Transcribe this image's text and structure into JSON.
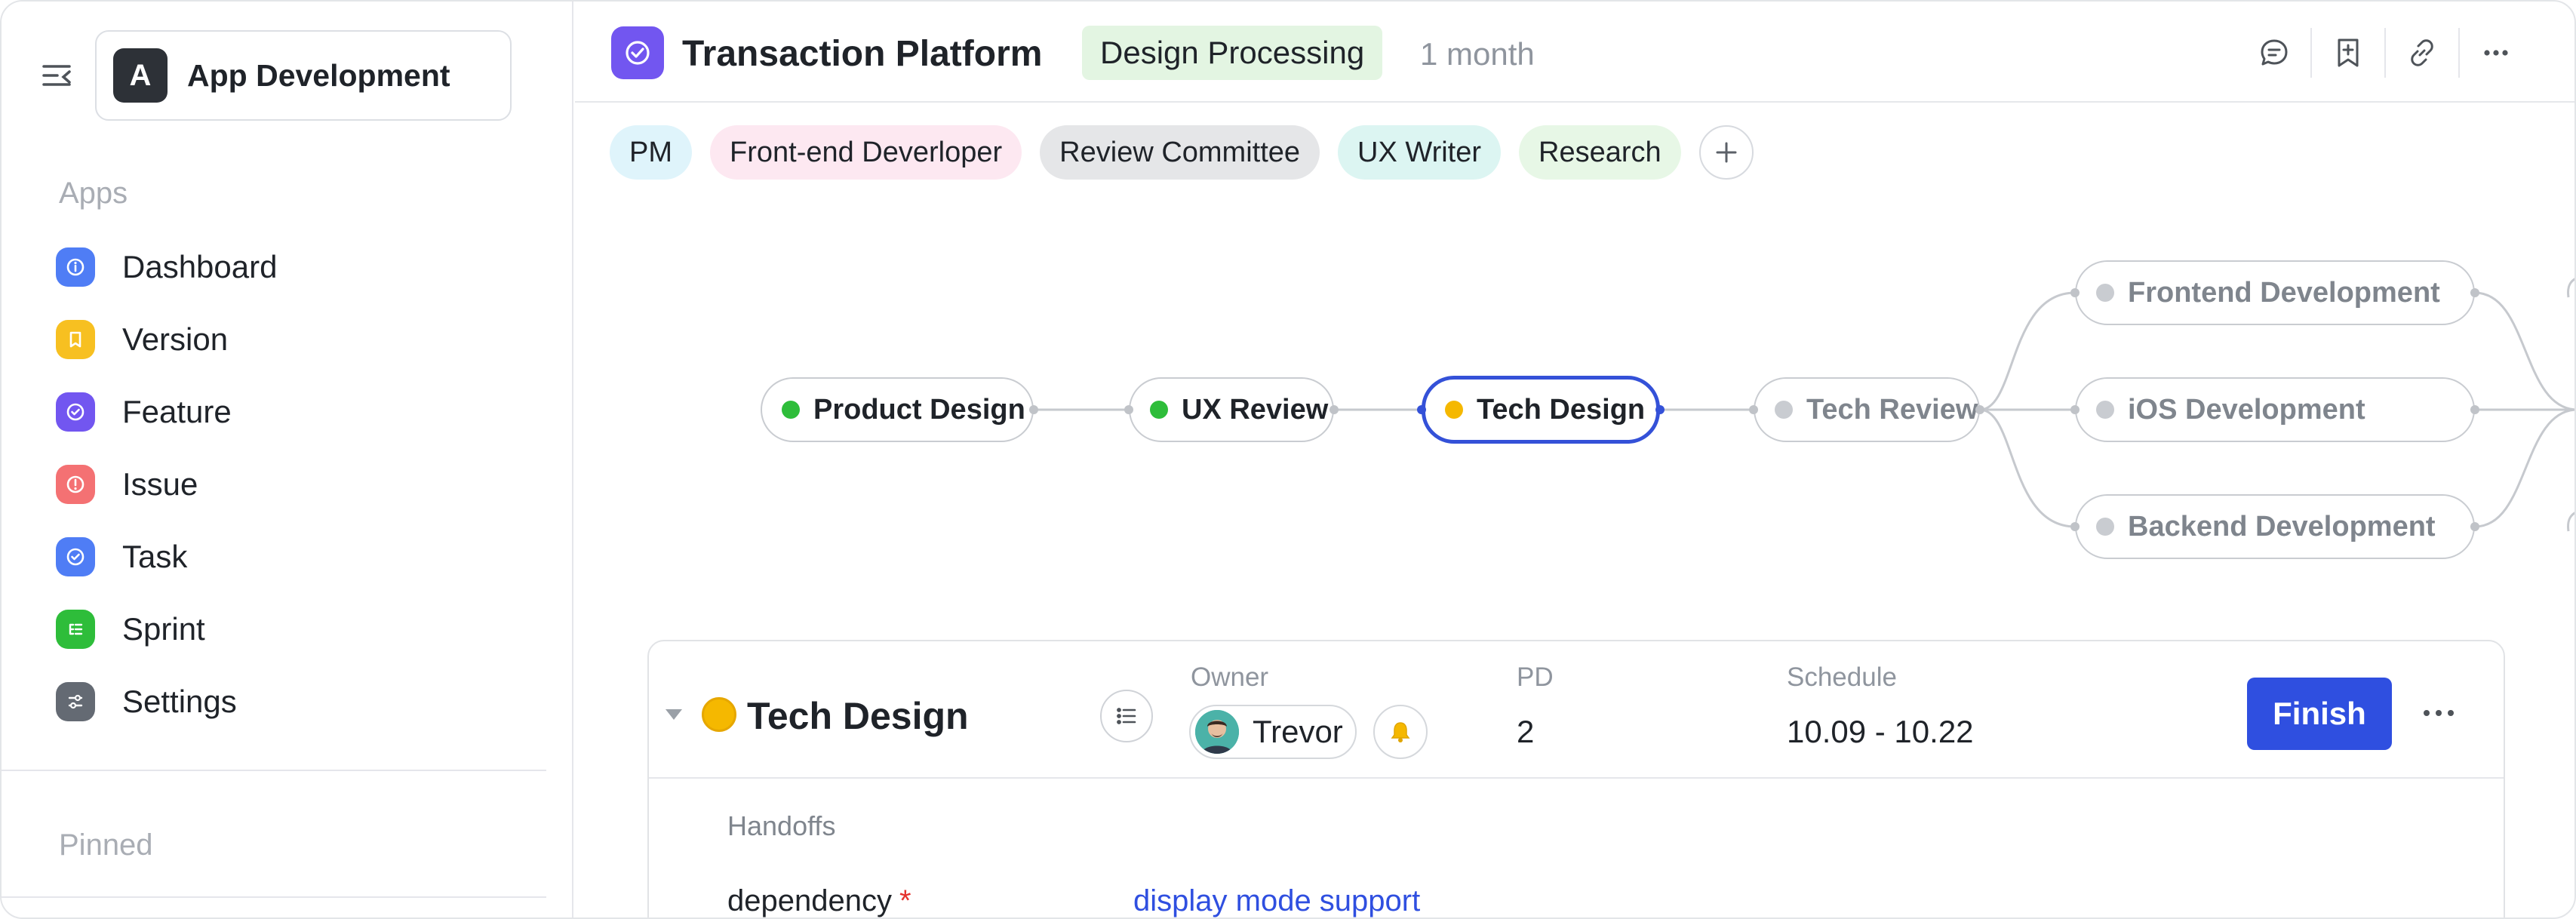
{
  "sidebar": {
    "workspace": {
      "initial": "A",
      "name": "App Development"
    },
    "apps_title": "Apps",
    "items": [
      {
        "label": "Dashboard",
        "icon": "info-icon",
        "color": "#4f7df5"
      },
      {
        "label": "Version",
        "icon": "bookmark-icon",
        "color": "#f7c021"
      },
      {
        "label": "Feature",
        "icon": "check-circle-icon",
        "color": "#7256f0"
      },
      {
        "label": "Issue",
        "icon": "alert-icon",
        "color": "#f47173"
      },
      {
        "label": "Task",
        "icon": "check-circle-icon",
        "color": "#4f7df5"
      },
      {
        "label": "Sprint",
        "icon": "list-icon",
        "color": "#2ebd3a"
      },
      {
        "label": "Settings",
        "icon": "sliders-icon",
        "color": "#646a73"
      }
    ],
    "pinned_title": "Pinned"
  },
  "header": {
    "title": "Transaction Platform",
    "status": "Design Processing",
    "duration": "1 month",
    "actions": [
      "comment-icon",
      "bookmark-add-icon",
      "link-icon",
      "more-icon"
    ]
  },
  "roles": [
    {
      "label": "PM",
      "color": "#dff4fb"
    },
    {
      "label": "Front-end Deverloper",
      "color": "#fde8f1"
    },
    {
      "label": "Review Committee",
      "color": "#e5e6e8"
    },
    {
      "label": "UX Writer",
      "color": "#dcf5f2"
    },
    {
      "label": "Research",
      "color": "#e7f7e6"
    }
  ],
  "flow": {
    "nodes": [
      {
        "label": "Product Design",
        "state": "done",
        "dot": "#2ebd3a"
      },
      {
        "label": "UX Review",
        "state": "done",
        "dot": "#2ebd3a"
      },
      {
        "label": "Tech Design",
        "state": "active",
        "dot": "#f5b800"
      },
      {
        "label": "Tech Review",
        "state": "pending",
        "dot": "#c9ccd1"
      },
      {
        "label": "Frontend Development",
        "state": "pending",
        "dot": "#c9ccd1"
      },
      {
        "label": "iOS Development",
        "state": "pending",
        "dot": "#c9ccd1"
      },
      {
        "label": "Backend Development",
        "state": "pending",
        "dot": "#c9ccd1"
      }
    ]
  },
  "task": {
    "name": "Tech Design",
    "owner_label": "Owner",
    "owner_name": "Trevor",
    "pd_label": "PD",
    "pd_value": "2",
    "schedule_label": "Schedule",
    "schedule_value": "10.09 - 10.22",
    "finish_label": "Finish",
    "handoffs_label": "Handoffs",
    "dependency_label": "dependency",
    "required_mark": "*",
    "dependency_value": "display mode support"
  }
}
